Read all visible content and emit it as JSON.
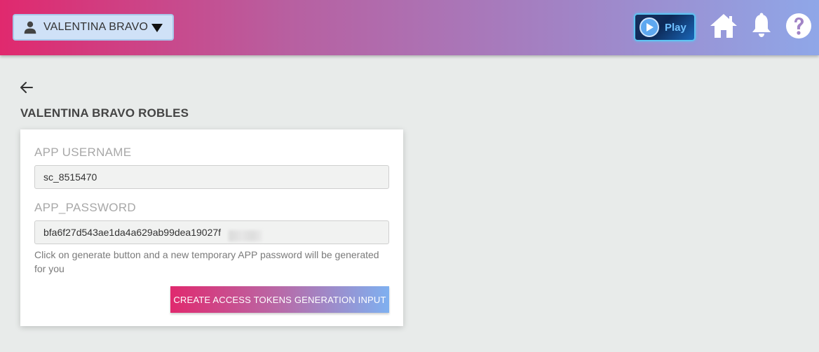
{
  "header": {
    "user_name": "VALENTINA BRAVO",
    "play_label": "Play",
    "icons": [
      "person-icon",
      "caret-down-icon",
      "play-icon",
      "home-icon",
      "bell-icon",
      "help-icon"
    ],
    "gradient_colors": [
      "#e0296e",
      "#b85fa0",
      "#a184c6",
      "#8fa7e8"
    ]
  },
  "page": {
    "title": "VALENTINA BRAVO ROBLES",
    "back_icon": "arrow-left-icon"
  },
  "form": {
    "username_label": "APP USERNAME",
    "username_value": "sc_8515470",
    "password_label": "APP_PASSWORD",
    "password_value": "bfa6f27d543ae1da4a629ab99dea19027f",
    "help_text": "Click on generate button and a new temporary APP password will be generated for you",
    "generate_button_label": "CREATE ACCESS TOKENS GENERATION INPUT"
  }
}
